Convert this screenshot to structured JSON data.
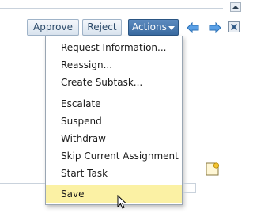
{
  "toolbar": {
    "approve_label": "Approve",
    "reject_label": "Reject",
    "actions_label": "Actions"
  },
  "menu": {
    "items": [
      "Request Information...",
      "Reassign...",
      "Create Subtask...",
      "Escalate",
      "Suspend",
      "Withdraw",
      "Skip Current Assignment",
      "Start Task",
      "Save"
    ],
    "highlighted": "Save"
  },
  "icons": {
    "back": "arrow-left-icon",
    "forward": "arrow-right-icon",
    "close": "close-icon",
    "note": "sticky-note-icon",
    "scroll": "scroll-up-icon",
    "cursor": "mouse-pointer-icon"
  },
  "colors": {
    "actions_button": "#3a6aa0",
    "highlight": "#fbf1a4",
    "nav_arrow": "#4a90d9"
  }
}
